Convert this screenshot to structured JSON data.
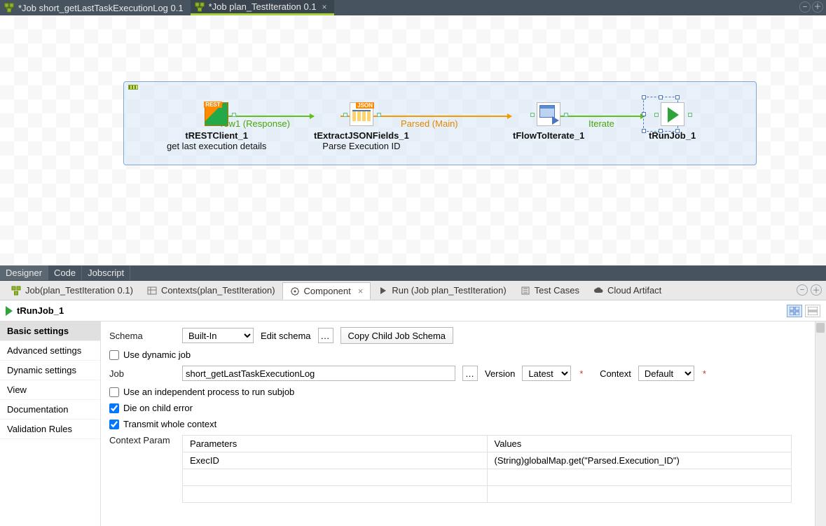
{
  "topTabs": [
    {
      "label": "*Job short_getLastTaskExecutionLog 0.1",
      "active": false
    },
    {
      "label": "*Job plan_TestIteration 0.1",
      "active": true
    }
  ],
  "modeTabs": {
    "designer": "Designer",
    "code": "Code",
    "jobscript": "Jobscript",
    "active": "Designer"
  },
  "canvas": {
    "nodes": {
      "rest": {
        "id": "tRESTClient_1",
        "sub": "get last execution details"
      },
      "json": {
        "id": "tExtractJSONFields_1",
        "sub": "Parse Execution ID"
      },
      "flow": {
        "id": "tFlowToIterate_1",
        "sub": ""
      },
      "run": {
        "id": "tRunJob_1",
        "sub": ""
      }
    },
    "conns": {
      "c1": "row1 (Response)",
      "c2": "Parsed (Main)",
      "c3": "Iterate"
    }
  },
  "lowerTabs": {
    "job": "Job(plan_TestIteration 0.1)",
    "contexts": "Contexts(plan_TestIteration)",
    "component": "Component",
    "run": "Run (Job plan_TestIteration)",
    "testcases": "Test Cases",
    "cloud": "Cloud Artifact"
  },
  "component": {
    "title": "tRunJob_1",
    "sideTabs": {
      "basic": "Basic settings",
      "advanced": "Advanced settings",
      "dynamic": "Dynamic settings",
      "view": "View",
      "doc": "Documentation",
      "validation": "Validation Rules"
    },
    "labels": {
      "schema": "Schema",
      "editSchema": "Edit schema",
      "copyChild": "Copy Child Job Schema",
      "useDynamic": "Use dynamic job",
      "jobLabel": "Job",
      "versionLabel": "Version",
      "contextLabel": "Context",
      "indep": "Use an independent process to run subjob",
      "dieOn": "Die on child error",
      "transmit": "Transmit whole context",
      "ctxParam": "Context Param"
    },
    "values": {
      "schemaSelect": "Built-In",
      "jobValue": "short_getLastTaskExecutionLog",
      "versionValue": "Latest",
      "contextValue": "Default",
      "useDynamic": false,
      "indep": false,
      "dieOn": true,
      "transmit": true
    },
    "paramsTable": {
      "headers": {
        "param": "Parameters",
        "val": "Values"
      },
      "rows": [
        {
          "param": "ExecID",
          "val": "(String)globalMap.get(\"Parsed.Execution_ID\")"
        }
      ]
    }
  }
}
